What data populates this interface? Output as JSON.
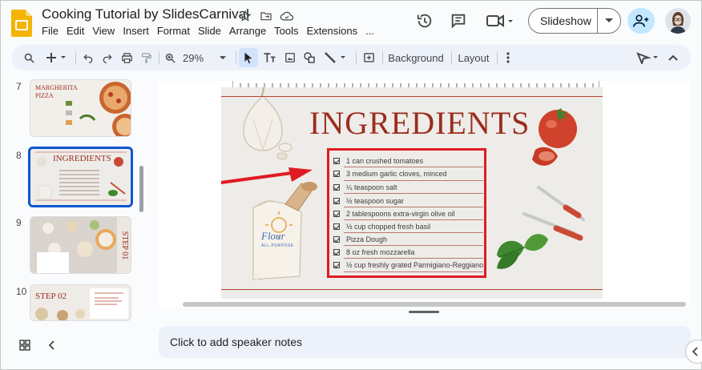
{
  "app": {
    "title": "Cooking Tutorial by SlidesCarnival",
    "menu": [
      "File",
      "Edit",
      "View",
      "Insert",
      "Format",
      "Slide",
      "Arrange",
      "Tools",
      "Extensions",
      "..."
    ],
    "slideshow_label": "Slideshow"
  },
  "toolbar": {
    "zoom": "29%",
    "background_label": "Background",
    "layout_label": "Layout"
  },
  "filmstrip": {
    "slides": [
      {
        "number": "7",
        "title": "MARGHERITA PIZZA"
      },
      {
        "number": "8",
        "title": "INGREDIENTS",
        "selected": true
      },
      {
        "number": "9",
        "title": "STEP 01"
      },
      {
        "number": "10",
        "title": "STEP 02"
      }
    ]
  },
  "slide": {
    "title": "INGREDIENTS",
    "flour_label": "Flour",
    "flour_sub": "ALL-PURPOSE",
    "ingredients": [
      "1 can crushed tomatoes",
      "3 medium garlic cloves, minced",
      "¼ teaspoon salt",
      "½ teaspoon sugar",
      "2 tablespoons extra-virgin olive oil",
      "½ cup chopped fresh basil",
      "Pizza Dough",
      "8 oz fresh mozzarella",
      "½ cup freshly grated Parmigiano-Reggiano"
    ]
  },
  "notes": {
    "placeholder": "Click to add speaker notes"
  },
  "colors": {
    "accent": "#0b57d0",
    "highlight_box": "#e01b24",
    "title_red": "#9b2c1f"
  }
}
